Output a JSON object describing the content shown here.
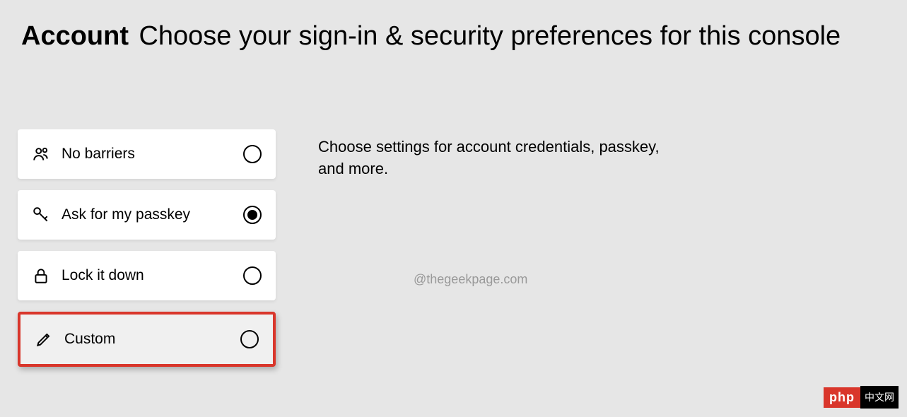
{
  "header": {
    "title": "Account",
    "subtitle": "Choose your sign-in & security preferences for this console"
  },
  "options": [
    {
      "id": "no-barriers",
      "label": "No barriers",
      "selected": false,
      "highlighted": false
    },
    {
      "id": "ask-passkey",
      "label": "Ask for my passkey",
      "selected": true,
      "highlighted": false
    },
    {
      "id": "lock-down",
      "label": "Lock it down",
      "selected": false,
      "highlighted": false
    },
    {
      "id": "custom",
      "label": "Custom",
      "selected": false,
      "highlighted": true
    }
  ],
  "description": "Choose settings for account credentials, passkey, and more.",
  "watermark": "@thegeekpage.com",
  "footer": {
    "brand": "php",
    "cn": "中文网"
  }
}
